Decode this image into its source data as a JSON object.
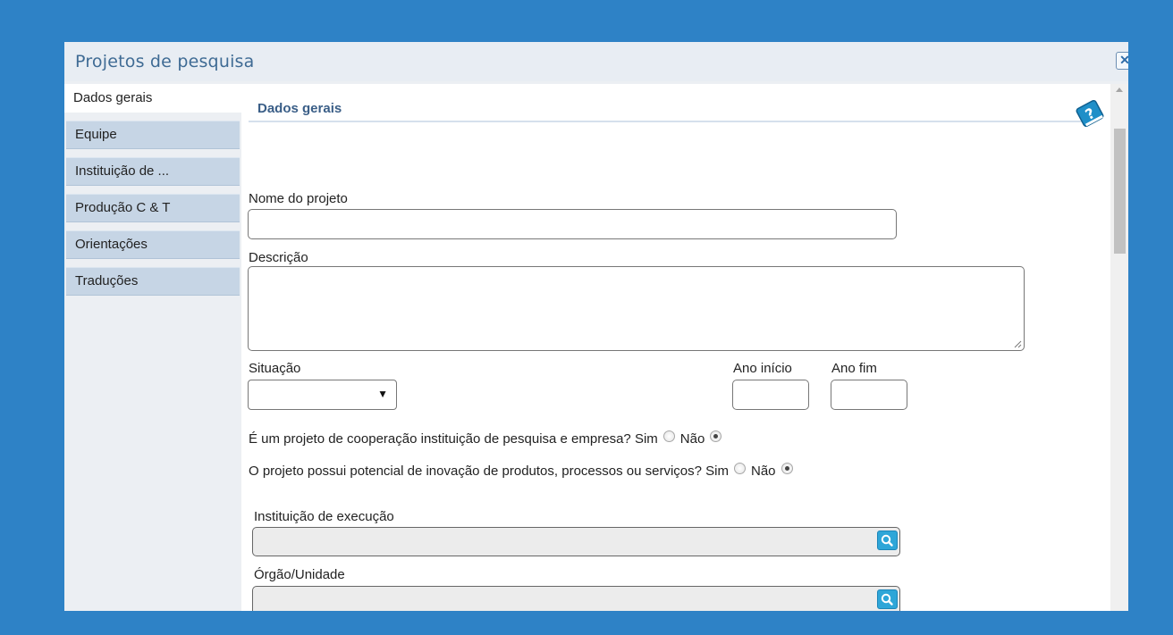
{
  "window": {
    "title": "Projetos de pesquisa"
  },
  "sidebar": {
    "tabs": [
      {
        "label": "Dados gerais",
        "active": true
      },
      {
        "label": "Equipe",
        "active": false
      },
      {
        "label": "Instituição de ...",
        "active": false
      },
      {
        "label": "Produção C & T",
        "active": false
      },
      {
        "label": "Orientações",
        "active": false
      },
      {
        "label": "Traduções",
        "active": false
      }
    ]
  },
  "form": {
    "section_title": "Dados gerais",
    "nome_label": "Nome do projeto",
    "nome_value": "",
    "descricao_label": "Descrição",
    "descricao_value": "",
    "situacao_label": "Situação",
    "situacao_value": "",
    "ano_inicio_label": "Ano início",
    "ano_inicio_value": "",
    "ano_fim_label": "Ano fim",
    "ano_fim_value": "",
    "q1_text": "É um projeto de cooperação instituição de pesquisa e empresa?",
    "q2_text": "O projeto possui potencial de inovação de produtos, processos ou serviços?",
    "sim_label": "Sim",
    "nao_label": "Não",
    "q1_selected": "Não",
    "q2_selected": "Não",
    "instituicao_label": "Instituição de execução",
    "instituicao_value": "",
    "orgao_label": "Órgão/Unidade",
    "orgao_value": ""
  },
  "icons": {
    "help": "help-book-icon",
    "close": "close-icon",
    "search": "search-icon"
  },
  "colors": {
    "background": "#2e82c6",
    "title": "#3f6b94",
    "tab_inactive": "#c6d5e5",
    "lookup_button": "#2ea6d8"
  }
}
